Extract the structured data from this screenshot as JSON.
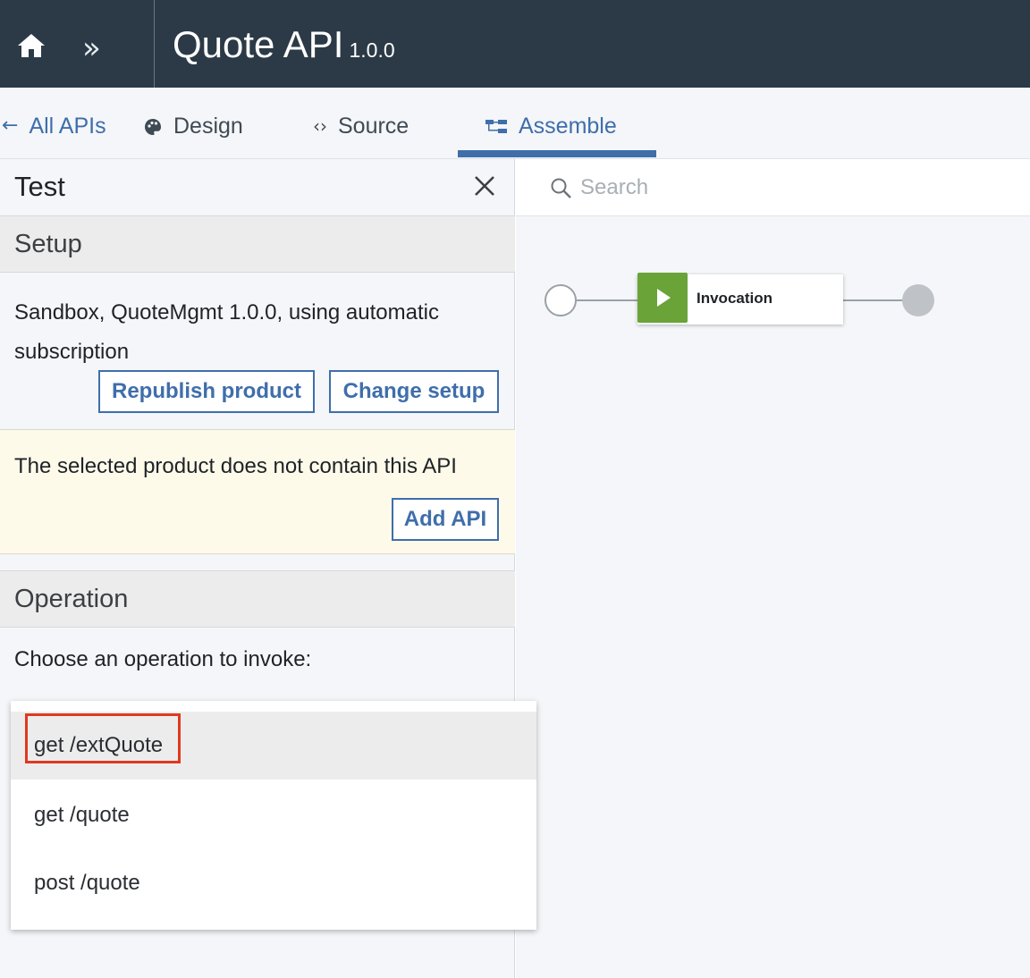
{
  "header": {
    "title": "Quote API",
    "version": "1.0.0",
    "home_icon": "home-icon",
    "expand_icon": "double-chevron-right-icon"
  },
  "tabs": [
    {
      "label": "All APIs",
      "icon": "arrow-left-icon"
    },
    {
      "label": "Design",
      "icon": "palette-icon"
    },
    {
      "label": "Source",
      "icon": "code-icon"
    },
    {
      "label": "Assemble",
      "icon": "assemble-icon",
      "active": true
    }
  ],
  "test_panel": {
    "title": "Test",
    "setup": {
      "heading": "Setup",
      "description": "Sandbox, QuoteMgmt 1.0.0, using automatic subscription",
      "republish_label": "Republish product",
      "change_setup_label": "Change setup"
    },
    "warning": {
      "message": "The selected product does not contain this API",
      "add_api_label": "Add API"
    },
    "operation": {
      "heading": "Operation",
      "prompt": "Choose an operation to invoke:",
      "options": [
        "get /extQuote",
        "get /quote",
        "post /quote"
      ],
      "highlighted_option": "get /extQuote"
    }
  },
  "canvas": {
    "search_placeholder": "Search",
    "policy_label": "Invocation"
  },
  "colors": {
    "header_bg": "#2b3a46",
    "accent": "#3f6eab",
    "policy_green": "#6aa338",
    "highlight_red": "#e0391f",
    "warning_bg": "#fdfaea"
  }
}
